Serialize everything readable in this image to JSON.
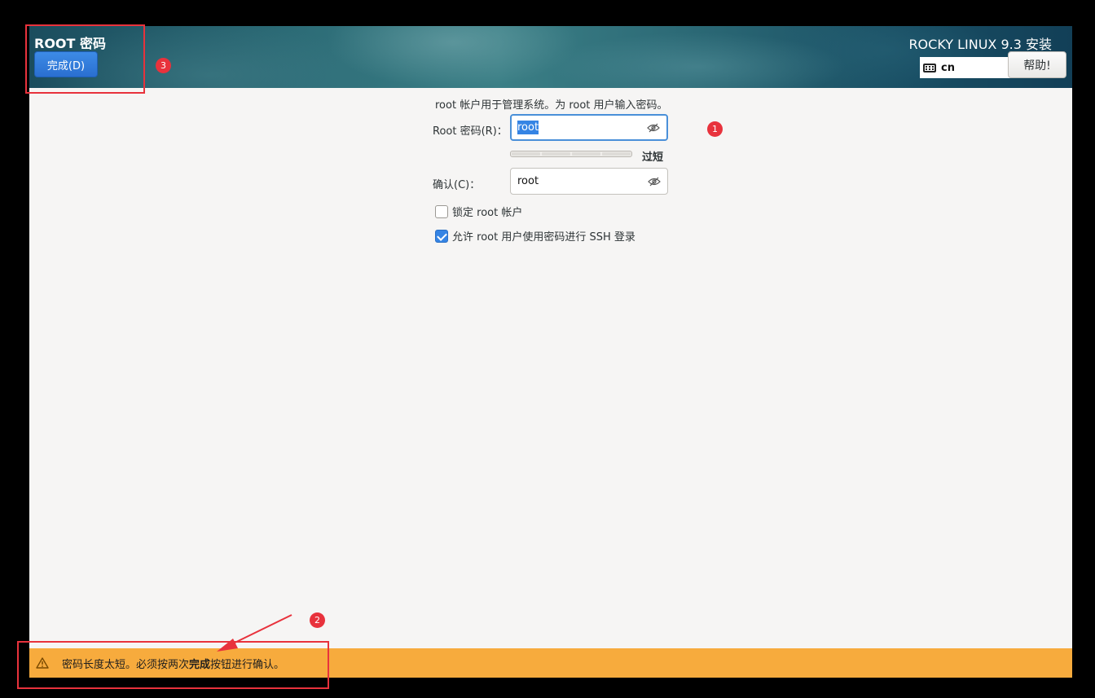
{
  "header": {
    "page_title": "ROOT 密码",
    "done_label": "完成(D)",
    "product_title": "ROCKY LINUX 9.3 安装",
    "keyboard_layout": "cn",
    "help_label": "帮助!"
  },
  "form": {
    "description": "root 帐户用于管理系统。为 root 用户输入密码。",
    "password_label": "Root 密码(R)：",
    "password_value": "root",
    "strength_label": "过短",
    "strength_level": 0,
    "confirm_label": "确认(C)：",
    "confirm_value": "root",
    "lock_root_label": "锁定 root 帐户",
    "lock_root_checked": false,
    "allow_ssh_label": "允许 root 用户使用密码进行 SSH 登录",
    "allow_ssh_checked": true
  },
  "warning": {
    "text_before": "密码长度太短。必须按两次",
    "text_bold": "完成",
    "text_after": "按钮进行确认。"
  },
  "annotations": {
    "badge_1": "1",
    "badge_2": "2",
    "badge_3": "3",
    "color": "#e8323c"
  },
  "colors": {
    "accent": "#3584e4",
    "warning": "#f7ab3d"
  }
}
